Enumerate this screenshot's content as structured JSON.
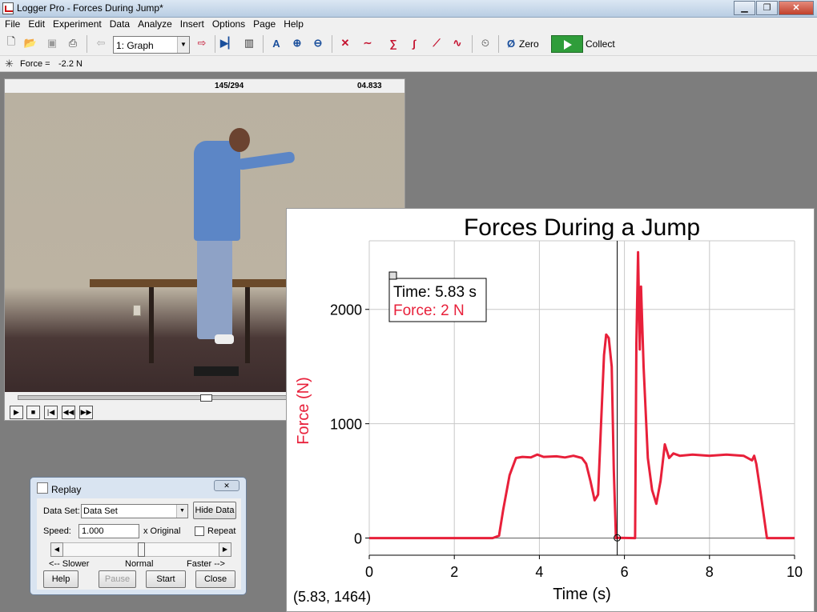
{
  "window": {
    "title": "Logger Pro - Forces During Jump*"
  },
  "menu": [
    "File",
    "Edit",
    "Experiment",
    "Data",
    "Analyze",
    "Insert",
    "Options",
    "Page",
    "Help"
  ],
  "toolbar": {
    "page_select": "1: Graph",
    "zero_label": "Zero",
    "collect_label": "Collect",
    "icons": [
      "new-file-icon",
      "open-folder-icon",
      "save-icon",
      "print-icon",
      "back-icon",
      "page-select",
      "next-page-icon",
      "video-play-icon",
      "sensor-icon",
      "autoscale-icon",
      "zoom-in-icon",
      "zoom-out-icon",
      "examine-icon",
      "tangent-icon",
      "statistics-icon",
      "integral-icon",
      "linear-fit-icon",
      "curve-fit-icon",
      "timer-icon",
      "zero-icon",
      "collect-icon"
    ]
  },
  "meter": {
    "label": "Force =",
    "value": "-2.2 N"
  },
  "video": {
    "frame": "145/294",
    "time": "04.833",
    "position_fraction": 0.49
  },
  "graph": {
    "tooltip_time": "Time: 5.83 s",
    "tooltip_force": "Force: 2 N",
    "examine_readout": "(5.83, 1464)",
    "line_color": "#e8203a",
    "cursor_time": 5.83
  },
  "chart_data": {
    "type": "line",
    "title": "Forces During a Jump",
    "xlabel": "Time (s)",
    "ylabel": "Force (N)",
    "xlim": [
      0,
      10
    ],
    "ylim": [
      -150,
      2600
    ],
    "xticks": [
      0,
      2,
      4,
      6,
      8,
      10
    ],
    "yticks": [
      0,
      1000,
      2000
    ],
    "grid": true,
    "series": [
      {
        "color": "#e8203a",
        "points": [
          [
            0,
            0
          ],
          [
            2.9,
            0
          ],
          [
            3.05,
            20
          ],
          [
            3.15,
            250
          ],
          [
            3.3,
            550
          ],
          [
            3.45,
            700
          ],
          [
            3.6,
            710
          ],
          [
            3.8,
            705
          ],
          [
            3.95,
            730
          ],
          [
            4.1,
            710
          ],
          [
            4.4,
            715
          ],
          [
            4.6,
            705
          ],
          [
            4.8,
            720
          ],
          [
            5.0,
            700
          ],
          [
            5.1,
            650
          ],
          [
            5.2,
            500
          ],
          [
            5.3,
            330
          ],
          [
            5.38,
            380
          ],
          [
            5.45,
            1000
          ],
          [
            5.52,
            1600
          ],
          [
            5.57,
            1780
          ],
          [
            5.63,
            1750
          ],
          [
            5.7,
            1500
          ],
          [
            5.75,
            600
          ],
          [
            5.8,
            0
          ],
          [
            5.83,
            2
          ],
          [
            6.25,
            0
          ],
          [
            6.28,
            1700
          ],
          [
            6.32,
            2500
          ],
          [
            6.36,
            1650
          ],
          [
            6.39,
            2200
          ],
          [
            6.45,
            1500
          ],
          [
            6.55,
            700
          ],
          [
            6.65,
            420
          ],
          [
            6.75,
            300
          ],
          [
            6.85,
            500
          ],
          [
            6.95,
            820
          ],
          [
            7.05,
            700
          ],
          [
            7.15,
            740
          ],
          [
            7.3,
            720
          ],
          [
            7.6,
            730
          ],
          [
            8.0,
            720
          ],
          [
            8.4,
            730
          ],
          [
            8.8,
            720
          ],
          [
            9.0,
            680
          ],
          [
            9.05,
            720
          ],
          [
            9.1,
            650
          ],
          [
            9.2,
            400
          ],
          [
            9.35,
            0
          ],
          [
            10,
            0
          ]
        ]
      }
    ]
  },
  "replay": {
    "title": "Replay",
    "dataset_label": "Data Set:",
    "dataset_value": "Data Set",
    "hide_data": "Hide Data",
    "speed_label": "Speed:",
    "speed_value": "1.000",
    "x_original": "x Original",
    "repeat": "Repeat",
    "slower": "<-- Slower",
    "normal": "Normal",
    "faster": "Faster -->",
    "help": "Help",
    "pause": "Pause",
    "start": "Start",
    "close": "Close",
    "speed_slider_fraction": 0.5
  }
}
